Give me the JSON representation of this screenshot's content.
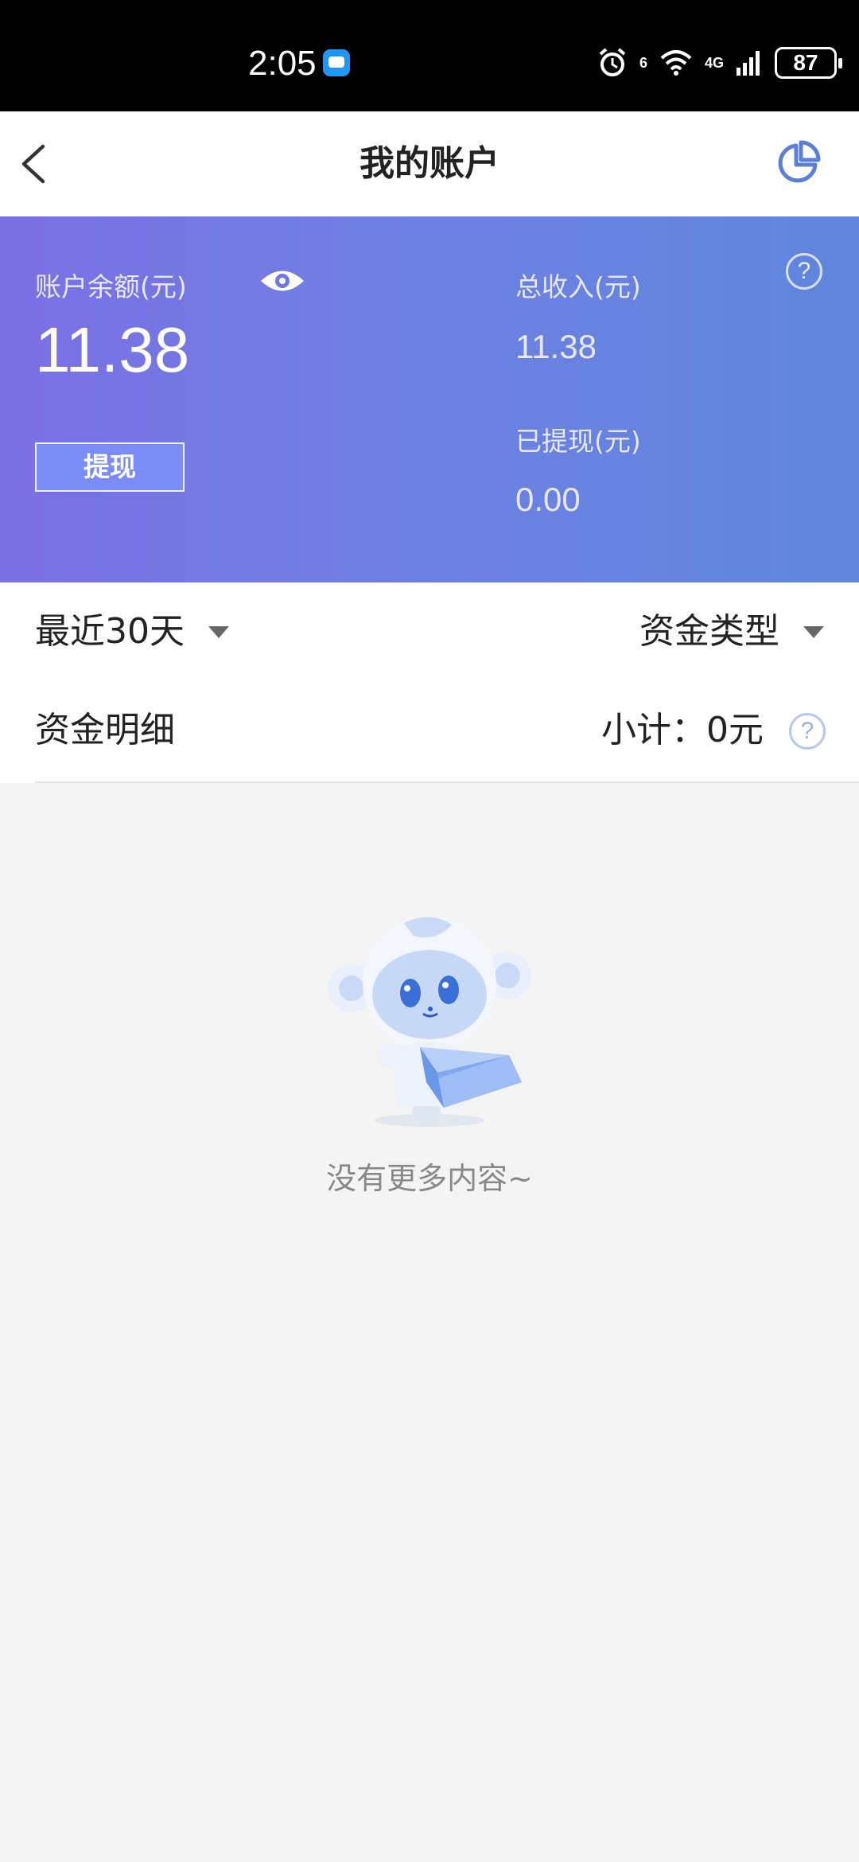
{
  "status_bar": {
    "time": "2:05",
    "network": "6",
    "network2": "4G",
    "battery": "87"
  },
  "header": {
    "title": "我的账户"
  },
  "account": {
    "balance_label": "账户余额(元)",
    "balance": "11.38",
    "withdraw_button": "提现",
    "income_label": "总收入(元)",
    "income": "11.38",
    "withdrawn_label": "已提现(元)",
    "withdrawn": "0.00",
    "help_icon": "?"
  },
  "filters": {
    "period": "最近30天",
    "fund_type": "资金类型"
  },
  "details": {
    "title": "资金明细",
    "subtotal": "小计：0元",
    "help_icon": "?"
  },
  "empty_state": {
    "message": "没有更多内容~"
  },
  "colors": {
    "banner_start": "#7b6fe4",
    "banner_end": "#5f86dc",
    "accent": "#5b7fd6"
  },
  "icons": {
    "back": "back-arrow-icon",
    "chart": "pie-chart-icon",
    "eye": "eye-icon",
    "empty": "monkey-mascot-icon"
  }
}
